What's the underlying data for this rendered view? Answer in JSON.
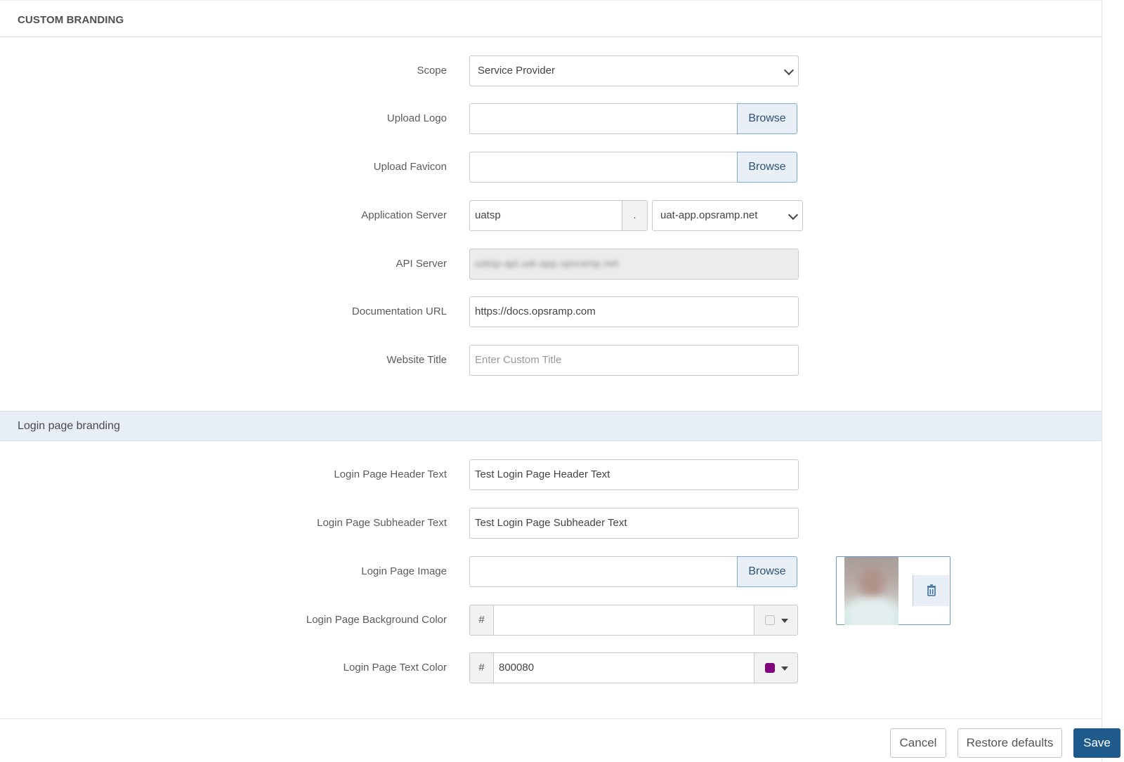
{
  "header": {
    "title": "CUSTOM BRANDING"
  },
  "form": {
    "scope": {
      "label": "Scope",
      "value": "Service Provider"
    },
    "upload_logo": {
      "label": "Upload Logo",
      "browse": "Browse"
    },
    "upload_favicon": {
      "label": "Upload Favicon",
      "browse": "Browse"
    },
    "app_server": {
      "label": "Application Server",
      "value": "uatsp",
      "separator": ".",
      "domain": "uat-app.opsramp.net"
    },
    "api_server": {
      "label": "API Server",
      "value": "uatsp-api.uat-app.opsramp.net"
    },
    "doc_url": {
      "label": "Documentation URL",
      "value": "https://docs.opsramp.com"
    },
    "website_title": {
      "label": "Website Title",
      "placeholder": "Enter Custom Title"
    }
  },
  "login_section": {
    "title": "Login page branding",
    "header_text": {
      "label": "Login Page Header Text",
      "value": "Test Login Page Header Text"
    },
    "subheader_text": {
      "label": "Login Page Subheader Text",
      "value": "Test Login Page Subheader Text"
    },
    "image": {
      "label": "Login Page Image",
      "browse": "Browse"
    },
    "bg_color": {
      "label": "Login Page Background Color",
      "prefix": "#",
      "value": "",
      "swatch": "#f0f0f0"
    },
    "text_color": {
      "label": "Login Page Text Color",
      "prefix": "#",
      "value": "800080",
      "swatch": "#800080"
    }
  },
  "footer": {
    "cancel": "Cancel",
    "restore": "Restore defaults",
    "save": "Save"
  }
}
